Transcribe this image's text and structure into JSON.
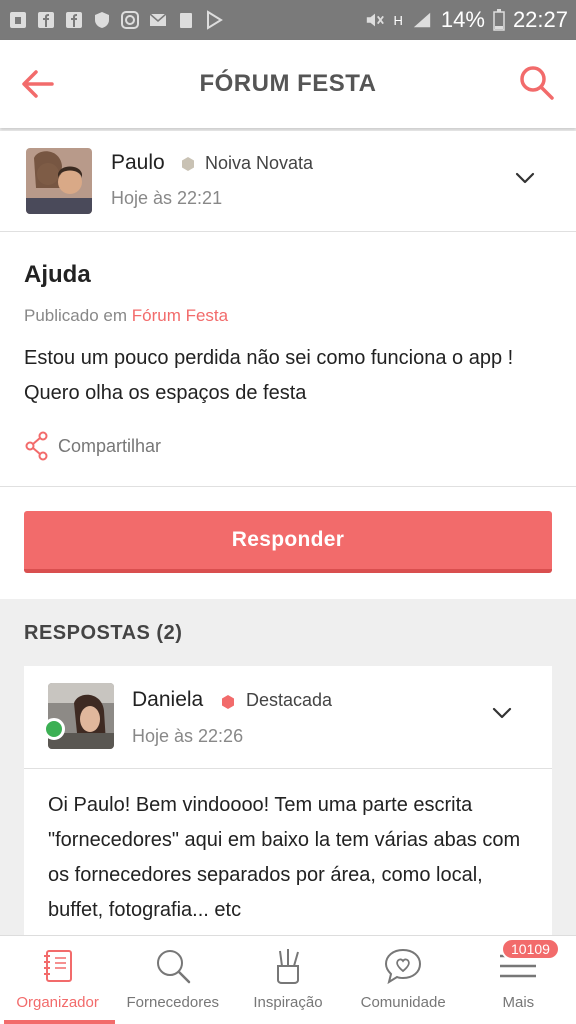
{
  "status_bar": {
    "battery": "14%",
    "time": "22:27",
    "network": "H"
  },
  "header": {
    "title": "FÓRUM FESTA",
    "back_icon": "arrow-left-icon",
    "search_icon": "search-icon"
  },
  "post": {
    "author": "Paulo",
    "badge": "Noiva Novata",
    "time": "Hoje às 22:21",
    "title": "Ajuda",
    "published_prefix": "Publicado em",
    "published_forum": "Fórum Festa",
    "body": "Estou um pouco perdida não sei como funciona o app ! Quero olha os espaços de festa",
    "share_label": "Compartilhar",
    "reply_label": "Responder"
  },
  "responses": {
    "title": "RESPOSTAS (2)",
    "items": [
      {
        "author": "Daniela",
        "badge": "Destacada",
        "time": "Hoje às 22:26",
        "body": "Oi Paulo! Bem vindoooo! Tem uma parte escrita \"fornecedores\" aqui em baixo la tem várias abas com os fornecedores separados por área, como local, buffet, fotografia... etc"
      }
    ]
  },
  "bottom_nav": {
    "items": [
      {
        "label": "Organizador",
        "icon": "notebook-icon",
        "active": true
      },
      {
        "label": "Fornecedores",
        "icon": "search-icon"
      },
      {
        "label": "Inspiração",
        "icon": "pencil-cup-icon"
      },
      {
        "label": "Comunidade",
        "icon": "chat-heart-icon"
      },
      {
        "label": "Mais",
        "icon": "menu-icon",
        "badge": "10109"
      }
    ]
  },
  "colors": {
    "accent": "#f26b6b",
    "online": "#3cb054",
    "status_bar": "#7a7a7a"
  }
}
